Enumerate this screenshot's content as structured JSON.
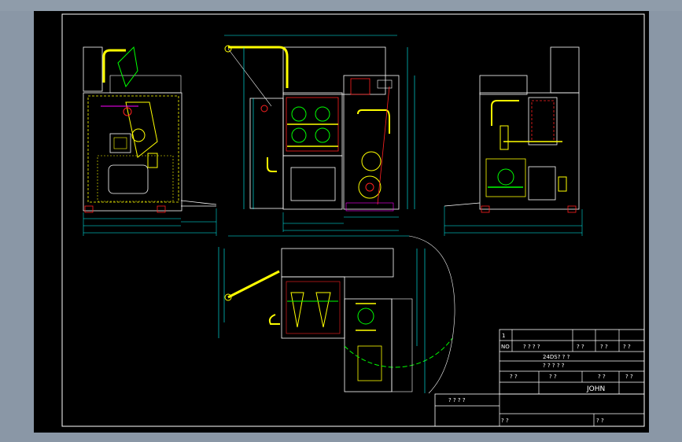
{
  "title_block": {
    "row1_number": "1",
    "header_no": "NO",
    "header_name": "? ? ? ?",
    "header_qty": "? ?",
    "header_material": "? ?",
    "header_remark": "? ?",
    "drawing_code": "24DS? ? ?",
    "drawing_name": "? ? ? ? ?",
    "label_a": "? ?",
    "label_b": "? ?",
    "label_c": "? ?",
    "label_d": "? ?",
    "designer": "JOHN",
    "side_label": "? ? ? ?",
    "bottom_left": "? ?",
    "bottom_right": "? ?"
  },
  "colors": {
    "sheet": "#000000",
    "frame": "#ffffff",
    "yellow": "#ffff00",
    "cyan": "#00ffff",
    "red": "#ff2020",
    "green": "#00ff00",
    "magenta": "#ff00ff"
  }
}
